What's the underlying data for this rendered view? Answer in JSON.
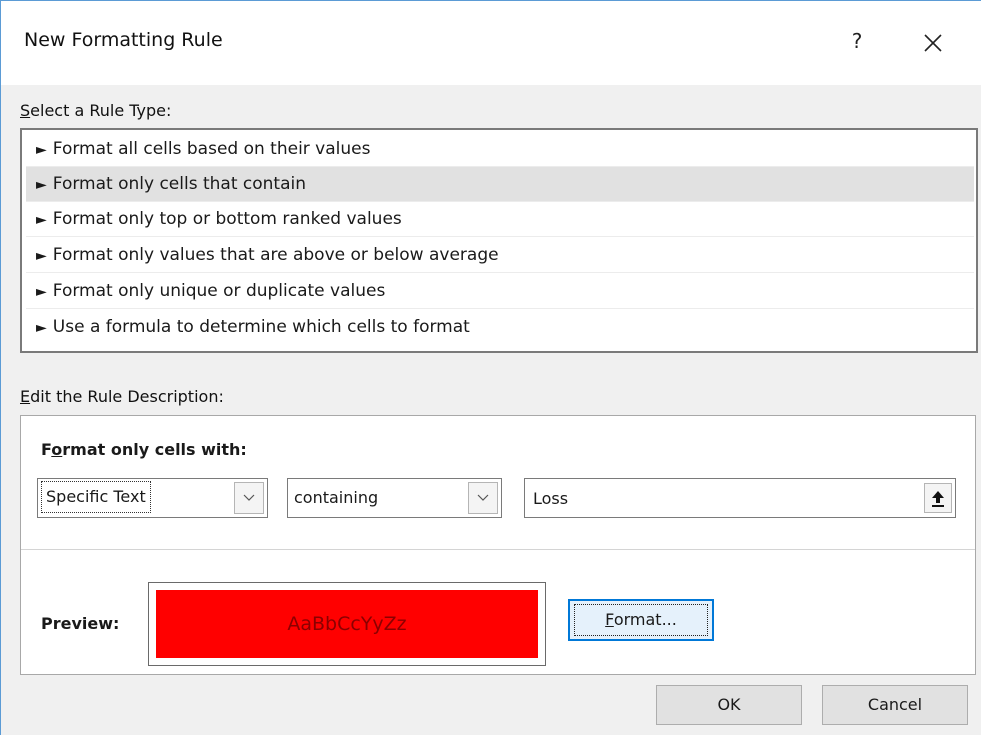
{
  "window": {
    "title": "New Formatting Rule",
    "help_label": "?"
  },
  "rule_type": {
    "label_first": "S",
    "label_rest": "elect a Rule Type:",
    "items": [
      {
        "label": "Format all cells based on their values",
        "selected": false
      },
      {
        "label": "Format only cells that contain",
        "selected": true
      },
      {
        "label": "Format only top or bottom ranked values",
        "selected": false
      },
      {
        "label": "Format only values that are above or below average",
        "selected": false
      },
      {
        "label": "Format only unique or duplicate values",
        "selected": false
      },
      {
        "label": "Use a formula to determine which cells to format",
        "selected": false
      }
    ]
  },
  "rule_description": {
    "label_first": "E",
    "label_rest": "dit the Rule Description:",
    "heading_pre": "F",
    "heading_underline": "o",
    "heading_post": "rmat only cells with:",
    "condition_type": "Specific Text",
    "operator": "containing",
    "value": "Loss",
    "preview_label": "Preview:",
    "preview_text": "AaBbCcYyZz",
    "preview_fill": "#ff0000",
    "preview_font_color": "#8b0000",
    "format_button_first": "F",
    "format_button_rest": "ormat..."
  },
  "buttons": {
    "ok": "OK",
    "cancel": "Cancel"
  },
  "icons": {
    "rule_bullet": "arrow-right-icon",
    "dropdown": "chevron-down-icon",
    "collapse": "collapse-dialog-icon",
    "close": "close-icon"
  }
}
